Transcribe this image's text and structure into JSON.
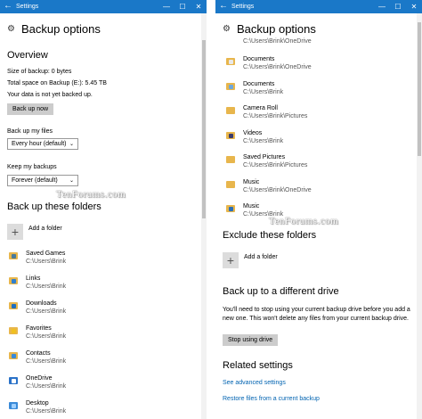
{
  "window": {
    "title": "Settings",
    "back_glyph": "←",
    "controls": [
      "—",
      "☐",
      "✕"
    ]
  },
  "header": {
    "title": "Backup options",
    "icon": "gear-icon"
  },
  "overview": {
    "heading": "Overview",
    "size_of_backup": "Size of backup: 0 bytes",
    "total_space": "Total space on Backup (E:): 5.45 TB",
    "status": "Your data is not yet backed up.",
    "back_up_now_label": "Back up now"
  },
  "back_up_files": {
    "label": "Back up my files",
    "selected": "Every hour (default)"
  },
  "keep_backups": {
    "label": "Keep my backups",
    "selected": "Forever (default)"
  },
  "backup_folders": {
    "heading": "Back up these folders",
    "add_label": "Add a folder",
    "items": [
      {
        "name": "Saved Games",
        "path": "C:\\Users\\Brink",
        "icon": "saved-games-folder-icon"
      },
      {
        "name": "Links",
        "path": "C:\\Users\\Brink",
        "icon": "links-folder-icon"
      },
      {
        "name": "Downloads",
        "path": "C:\\Users\\Brink",
        "icon": "downloads-folder-icon"
      },
      {
        "name": "Favorites",
        "path": "C:\\Users\\Brink",
        "icon": "favorites-folder-icon"
      },
      {
        "name": "Contacts",
        "path": "C:\\Users\\Brink",
        "icon": "contacts-folder-icon"
      },
      {
        "name": "OneDrive",
        "path": "C:\\Users\\Brink",
        "icon": "onedrive-folder-icon"
      },
      {
        "name": "Desktop",
        "path": "C:\\Users\\Brink",
        "icon": "desktop-folder-icon"
      }
    ]
  },
  "right_list": {
    "top_partial_path": "C:\\Users\\Brink\\OneDrive",
    "items": [
      {
        "name": "Documents",
        "path": "C:\\Users\\Brink\\OneDrive",
        "icon": "documents-folder-icon"
      },
      {
        "name": "Documents",
        "path": "C:\\Users\\Brink",
        "icon": "documents-folder-icon"
      },
      {
        "name": "Camera Roll",
        "path": "C:\\Users\\Brink\\Pictures",
        "icon": "camera-roll-folder-icon"
      },
      {
        "name": "Videos",
        "path": "C:\\Users\\Brink",
        "icon": "videos-folder-icon"
      },
      {
        "name": "Saved Pictures",
        "path": "C:\\Users\\Brink\\Pictures",
        "icon": "saved-pictures-folder-icon"
      },
      {
        "name": "Music",
        "path": "C:\\Users\\Brink\\OneDrive",
        "icon": "music-folder-icon"
      },
      {
        "name": "Music",
        "path": "C:\\Users\\Brink",
        "icon": "music-folder-icon"
      }
    ]
  },
  "exclude": {
    "heading": "Exclude these folders",
    "add_label": "Add a folder"
  },
  "different_drive": {
    "heading": "Back up to a different drive",
    "description": "You'll need to stop using your current backup drive before you add a new one. This won't delete any files from your current backup drive.",
    "stop_label": "Stop using drive"
  },
  "related": {
    "heading": "Related settings",
    "link1": "See advanced settings",
    "link2": "Restore files from a current backup"
  },
  "watermark": "TenForums.com",
  "colors": {
    "titlebar": "#1a78c8",
    "link": "#0063b1",
    "button": "#cccccc",
    "folder": "#e8b64c"
  }
}
